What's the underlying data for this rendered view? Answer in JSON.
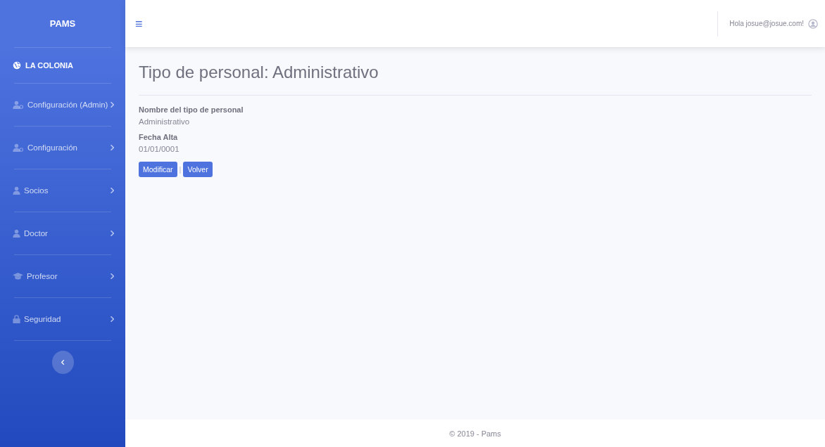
{
  "sidebar": {
    "brand": "PAMS",
    "heading": "LA COLONIA",
    "items": [
      {
        "label": "Configuración (Admin)",
        "expanded": false
      },
      {
        "label": "Configuración",
        "expanded": false
      },
      {
        "label": "Socios",
        "expanded": false
      },
      {
        "label": "Doctor",
        "expanded": false
      },
      {
        "label": "Profesor",
        "expanded": false
      },
      {
        "label": "Seguridad",
        "expanded": false
      }
    ]
  },
  "topbar": {
    "menu_glyph": "≡",
    "greeting": "Hola josue@josue.com!"
  },
  "page": {
    "title": "Tipo de personal: Administrativo",
    "fields": [
      {
        "label": "Nombre del tipo de personal",
        "value": "Administrativo"
      },
      {
        "label": "Fecha Alta",
        "value": "01/01/0001"
      }
    ],
    "buttons": [
      "Modificar",
      "Volver"
    ],
    "separator": "|"
  },
  "footer": "© 2019 - Pams"
}
